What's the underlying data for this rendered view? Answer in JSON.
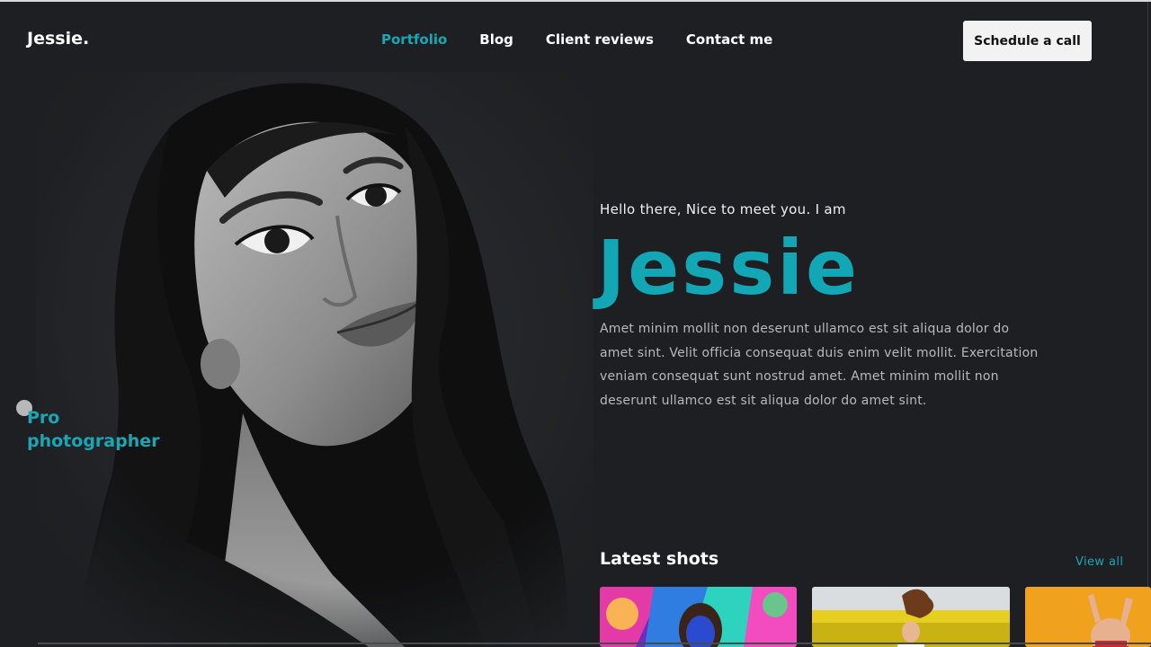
{
  "header": {
    "logo": "Jessie.",
    "nav": [
      {
        "label": "Portfolio",
        "active": true
      },
      {
        "label": "Blog",
        "active": false
      },
      {
        "label": "Client reviews",
        "active": false
      },
      {
        "label": "Contact me",
        "active": false
      }
    ],
    "cta_label": "Schedule a call"
  },
  "hero": {
    "badge_line1": "Pro",
    "badge_line2": "photographer",
    "greeting": "Hello there, Nice to meet you. I am",
    "name": "Jessie",
    "bio": "Amet minim mollit non deserunt ullamco est sit aliqua dolor do amet sint. Velit officia consequat duis enim velit mollit. Exercitation veniam consequat sunt nostrud amet. Amet minim mollit non deserunt ullamco est sit aliqua dolor do amet sint."
  },
  "shots": {
    "title": "Latest shots",
    "view_all": "View all",
    "items": [
      {
        "subject": "colorful-abstract-portrait"
      },
      {
        "subject": "field-hair-flip"
      },
      {
        "subject": "orange-backdrop-portrait"
      }
    ]
  },
  "colors": {
    "accent": "#1aa7b5",
    "background": "#1e1f22",
    "button_bg": "#f2f2f2",
    "body_text": "#b9b9bc"
  }
}
